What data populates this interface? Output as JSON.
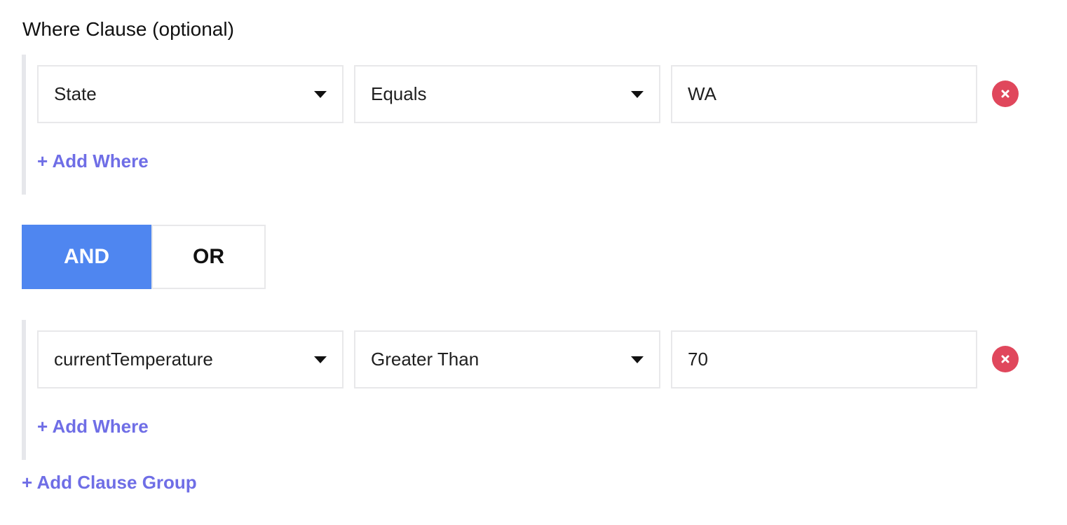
{
  "heading": "Where Clause (optional)",
  "clause_groups": [
    {
      "field": "State",
      "operator": "Equals",
      "value": "WA",
      "add_where_label": "+ Add Where"
    },
    {
      "field": "currentTemperature",
      "operator": "Greater Than",
      "value": "70",
      "add_where_label": "+ Add Where"
    }
  ],
  "logic_toggle": {
    "and_label": "AND",
    "or_label": "OR",
    "selected": "AND"
  },
  "add_clause_group_label": "+ Add Clause Group",
  "colors": {
    "accent_blue": "#4f86f0",
    "link_purple": "#6f6ee6",
    "remove_red": "#e0475c",
    "border_gray": "#e8e8ea"
  },
  "icons": {
    "dropdown": "caret-down-icon",
    "remove": "close-icon"
  }
}
